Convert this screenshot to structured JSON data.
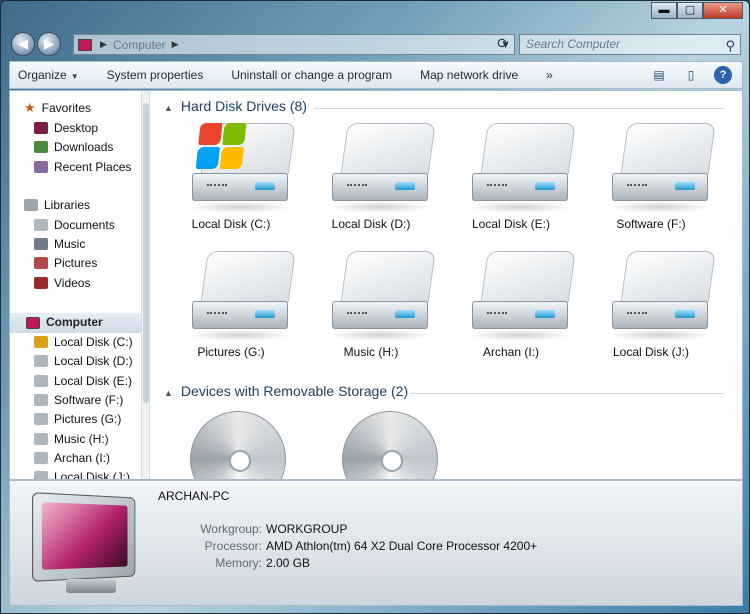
{
  "window": {
    "caption_buttons": {
      "minimize": "▬",
      "maximize": "▢",
      "close": "✕"
    }
  },
  "address": {
    "location": "Computer",
    "search_placeholder": "Search Computer"
  },
  "toolbar": {
    "items": [
      "Organize",
      "System properties",
      "Uninstall or change a program",
      "Map network drive",
      "»"
    ]
  },
  "nav": {
    "favorites": "Favorites",
    "favorites_items": [
      "Desktop",
      "Downloads",
      "Recent Places"
    ],
    "libraries": "Libraries",
    "libraries_items": [
      "Documents",
      "Music",
      "Pictures",
      "Videos"
    ],
    "computer": "Computer",
    "computer_items": [
      "Local Disk (C:)",
      "Local Disk (D:)",
      "Local Disk (E:)",
      "Software (F:)",
      "Pictures (G:)",
      "Music (H:)",
      "Archan (I:)",
      "Local Disk (J:)"
    ]
  },
  "content": {
    "hard_disks_header": "Hard Disk Drives (8)",
    "drives": [
      "Local Disk (C:)",
      "Local Disk (D:)",
      "Local Disk (E:)",
      "Software (F:)",
      "Pictures (G:)",
      "Music (H:)",
      "Archan (I:)",
      "Local Disk (J:)"
    ],
    "removable_header": "Devices with Removable Storage (2)"
  },
  "details": {
    "name": "ARCHAN-PC",
    "workgroup_label": "Workgroup:",
    "workgroup_value": "WORKGROUP",
    "processor_label": "Processor:",
    "processor_value": "AMD Athlon(tm) 64 X2 Dual Core Processor 4200+",
    "memory_label": "Memory:",
    "memory_value": "2.00 GB"
  },
  "colors": {
    "accent": "#1e3f66",
    "window_frame": "#3f6b8a"
  }
}
